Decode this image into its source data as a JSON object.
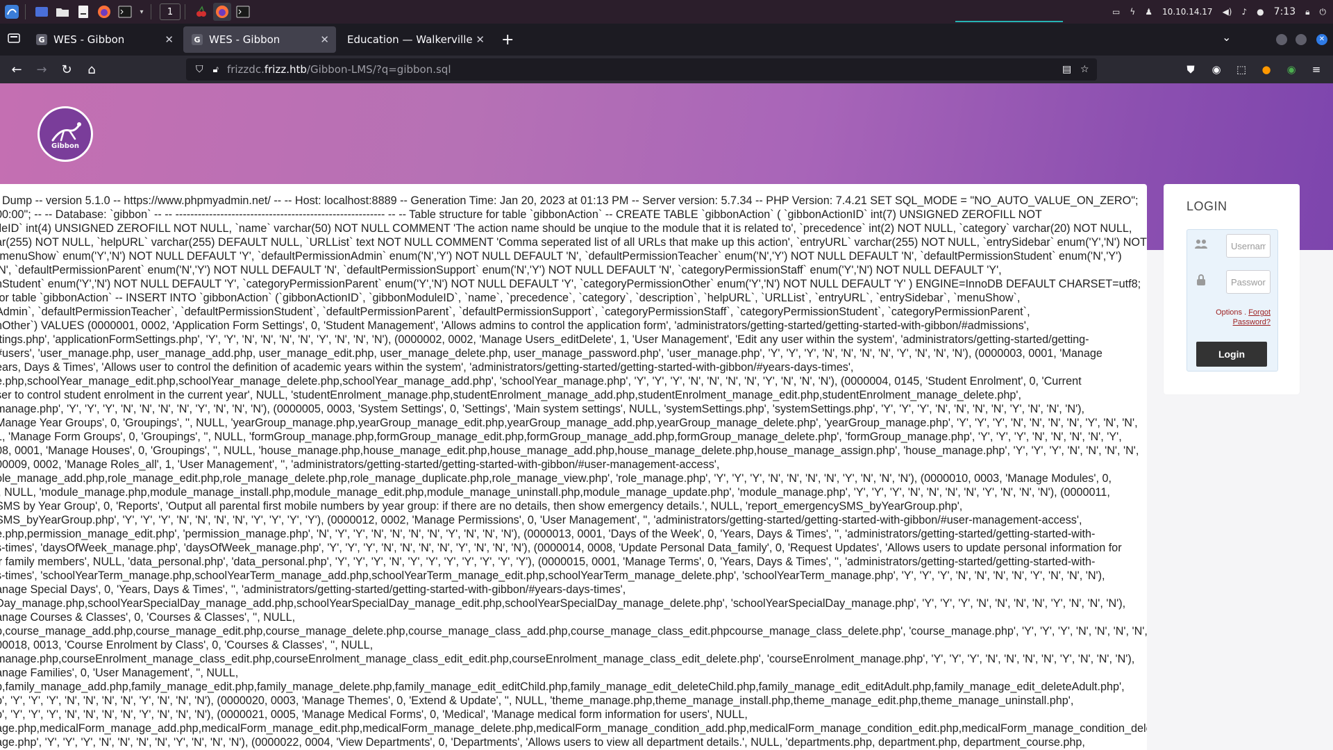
{
  "system_panel": {
    "workspace": "1",
    "ip": "10.10.14.17",
    "time": "7:13"
  },
  "browser": {
    "tabs": [
      {
        "title": "WES - Gibbon",
        "favicon": "G",
        "active": false
      },
      {
        "title": "WES - Gibbon",
        "favicon": "G",
        "active": true
      },
      {
        "title": "Education — Walkerville Elem",
        "favicon": "",
        "active": false
      }
    ],
    "url": {
      "pre": "frizzdc.",
      "host": "frizz.htb",
      "path": "/Gibbon-LMS/?q=gibbon.sql"
    }
  },
  "site": {
    "logo_text": "Gibbon"
  },
  "sql_lines": [
    ". Dump -- version 5.1.0 -- https://www.phpmyadmin.net/ -- -- Host: localhost:8889 -- Generation Time: Jan 20, 2023 at 01:13 PM -- Server version: 5.7.34 -- PHP Version: 7.4.21 SET SQL_MODE = \"NO_AUTO_VALUE_ON_ZERO\";",
    "00:00\"; -- -- Database: `gibbon` -- -- -------------------------------------------------------- -- -- Table structure for table `gibbonAction` -- CREATE TABLE `gibbonAction` ( `gibbonActionID` int(7) UNSIGNED ZEROFILL NOT",
    "ıleID` int(4) UNSIGNED ZEROFILL NOT NULL, `name` varchar(50) NOT NULL COMMENT 'The action name should be unqiue to the module that it is related to', `precedence` int(2) NOT NULL, `category` varchar(20) NOT NULL,",
    "ar(255) NOT NULL, `helpURL` varchar(255) DEFAULT NULL, `URLList` text NOT NULL COMMENT 'Comma seperated list of all URLs that make up this action', `entryURL` varchar(255) NOT NULL, `entrySidebar` enum('Y','N') NOT",
    "`menuShow` enum('Y','N') NOT NULL DEFAULT 'Y', `defaultPermissionAdmin` enum('N','Y') NOT NULL DEFAULT 'N', `defaultPermissionTeacher` enum('N','Y') NOT NULL DEFAULT 'N', `defaultPermissionStudent` enum('N','Y')",
    "'N', `defaultPermissionParent` enum('N','Y') NOT NULL DEFAULT 'N', `defaultPermissionSupport` enum('N','Y') NOT NULL DEFAULT 'N', `categoryPermissionStaff` enum('Y','N') NOT NULL DEFAULT 'Y',",
    "nStudent` enum('Y','N') NOT NULL DEFAULT 'Y', `categoryPermissionParent` enum('Y','N') NOT NULL DEFAULT 'Y', `categoryPermissionOther` enum('Y','N') NOT NULL DEFAULT 'Y' ) ENGINE=InnoDB DEFAULT CHARSET=utf8;",
    "for table `gibbonAction` -- INSERT INTO `gibbonAction` (`gibbonActionID`, `gibbonModuleID`, `name`, `precedence`, `category`, `description`, `helpURL`, `URLList`, `entryURL`, `entrySidebar`, `menuShow`,",
    "Admin`, `defaultPermissionTeacher`, `defaultPermissionStudent`, `defaultPermissionParent`, `defaultPermissionSupport`, `categoryPermissionStaff`, `categoryPermissionStudent`, `categoryPermissionParent`,",
    "nOther`) VALUES (0000001, 0002, 'Application Form Settings', 0, 'Student Management', 'Allows admins to control the application form', 'administrators/getting-started/getting-started-with-gibbon/#admissions',",
    "ttings.php', 'applicationFormSettings.php', 'Y', 'Y', 'N', 'N', 'N', 'N', 'Y', 'N', 'N', 'N'), (0000002, 0002, 'Manage Users_editDelete', 1, 'User Management', 'Edit any user within the system', 'administrators/getting-started/getting-",
    "#users', 'user_manage.php, user_manage_add.php, user_manage_edit.php, user_manage_delete.php, user_manage_password.php', 'user_manage.php', 'Y', 'Y', 'Y', 'N', 'N', 'N', 'N', 'Y', 'N', 'N', 'N'), (0000003, 0001, 'Manage",
    "ears, Days & Times', 'Allows user to control the definition of academic years within the system', 'administrators/getting-started/getting-started-with-gibbon/#years-days-times',",
    "e.php,schoolYear_manage_edit.php,schoolYear_manage_delete.php,schoolYear_manage_add.php', 'schoolYear_manage.php', 'Y', 'Y', 'Y', 'N', 'N', 'N', 'N', 'Y', 'N', 'N', 'N'), (0000004, 0145, 'Student Enrolment', 0, 'Current",
    "ser to control student enrolment in the current year', NULL, 'studentEnrolment_manage.php,studentEnrolment_manage_add.php,studentEnrolment_manage_edit.php,studentEnrolment_manage_delete.php',",
    "manage.php', 'Y', 'Y', 'Y', 'N', 'N', 'N', 'N', 'Y', 'N', 'N', 'N'), (0000005, 0003, 'System Settings', 0, 'Settings', 'Main system settings', NULL, 'systemSettings.php', 'systemSettings.php', 'Y', 'Y', 'Y', 'N', 'N', 'N', 'N', 'Y', 'N', 'N', 'N'),",
    "Manage Year Groups', 0, 'Groupings', '', NULL, 'yearGroup_manage.php,yearGroup_manage_edit.php,yearGroup_manage_add.php,yearGroup_manage_delete.php', 'yearGroup_manage.php', 'Y', 'Y', 'Y', 'N', 'N', 'N', 'N', 'Y', 'N', 'N',",
    "1, 'Manage Form Groups', 0, 'Groupings', '', NULL, 'formGroup_manage.php,formGroup_manage_edit.php,formGroup_manage_add.php,formGroup_manage_delete.php', 'formGroup_manage.php', 'Y', 'Y', 'Y', 'N', 'N', 'N', 'N', 'Y',",
    "08, 0001, 'Manage Houses', 0, 'Groupings', '', NULL, 'house_manage.php,house_manage_edit.php,house_manage_add.php,house_manage_delete.php,house_manage_assign.php', 'house_manage.php', 'Y', 'Y', 'Y', 'N', 'N', 'N', 'N',",
    "00009, 0002, 'Manage Roles_all', 1, 'User Management', '', 'administrators/getting-started/getting-started-with-gibbon/#user-management-access',",
    "ole_manage_add.php,role_manage_edit.php,role_manage_delete.php,role_manage_duplicate.php,role_manage_view.php', 'role_manage.php', 'Y', 'Y', 'Y', 'N', 'N', 'N', 'N', 'Y', 'N', 'N', 'N'), (0000010, 0003, 'Manage Modules', 0,",
    "', NULL, 'module_manage.php,module_manage_install.php,module_manage_edit.php,module_manage_uninstall.php,module_manage_update.php', 'module_manage.php', 'Y', 'Y', 'Y', 'N', 'N', 'N', 'N', 'Y', 'N', 'N', 'N'), (0000011,",
    "SMS by Year Group', 0, 'Reports', 'Output all parental first mobile numbers by year group: if there are no details, then show emergency details.', NULL, 'report_emergencySMS_byYearGroup.php',",
    "SMS_byYearGroup.php', 'Y', 'Y', 'Y', 'N', 'N', 'N', 'N', 'Y', 'Y', 'Y', 'Y'), (0000012, 0002, 'Manage Permissions', 0, 'User Management', '', 'administrators/getting-started/getting-started-with-gibbon/#user-management-access',",
    "e.php,permission_manage_edit.php', 'permission_manage.php', 'N', 'Y', 'Y', 'N', 'N', 'N', 'N', 'Y', 'N', 'N', 'N'), (0000013, 0001, 'Days of the Week', 0, 'Years, Days & Times', '', 'administrators/getting-started/getting-started-with-",
    "s-times', 'daysOfWeek_manage.php', 'daysOfWeek_manage.php', 'Y', 'Y', 'Y', 'N', 'N', 'N', 'N', 'Y', 'N', 'N', 'N'), (0000014, 0008, 'Update Personal Data_family', 0, 'Request Updates', 'Allows users to update personal information for",
    "ir family members', NULL, 'data_personal.php', 'data_personal.php', 'Y', 'Y', 'Y', 'N', 'Y', 'Y', 'Y', 'Y', 'Y', 'Y', 'Y'), (0000015, 0001, 'Manage Terms', 0, 'Years, Days & Times', '', 'administrators/getting-started/getting-started-with-",
    "s-times', 'schoolYearTerm_manage.php,schoolYearTerm_manage_add.php,schoolYearTerm_manage_edit.php,schoolYearTerm_manage_delete.php', 'schoolYearTerm_manage.php', 'Y', 'Y', 'Y', 'N', 'N', 'N', 'N', 'Y', 'N', 'N', 'N'),",
    "anage Special Days', 0, 'Years, Days & Times', '', 'administrators/getting-started/getting-started-with-gibbon/#years-days-times',",
    "Day_manage.php,schoolYearSpecialDay_manage_add.php,schoolYearSpecialDay_manage_edit.php,schoolYearSpecialDay_manage_delete.php', 'schoolYearSpecialDay_manage.php', 'Y', 'Y', 'Y', 'N', 'N', 'N', 'N', 'Y', 'N', 'N', 'N'),",
    "anage Courses & Classes', 0, 'Courses & Classes', '', NULL,",
    "p,course_manage_add.php,course_manage_edit.php,course_manage_delete.php,course_manage_class_add.php,course_manage_class_edit.phpcourse_manage_class_delete.php', 'course_manage.php', 'Y', 'Y', 'Y', 'N', 'N', 'N', 'N',",
    "00018, 0013, 'Course Enrolment by Class', 0, 'Courses & Classes', '', NULL,",
    "manage.php,courseEnrolment_manage_class_edit.php,courseEnrolment_manage_class_edit_edit.php,courseEnrolment_manage_class_edit_delete.php', 'courseEnrolment_manage.php', 'Y', 'Y', 'Y', 'N', 'N', 'N', 'N', 'Y', 'N', 'N', 'N'),",
    "anage Families', 0, 'User Management', '', NULL,",
    "p,family_manage_add.php,family_manage_edit.php,family_manage_delete.php,family_manage_edit_editChild.php,family_manage_edit_deleteChild.php,family_manage_edit_editAdult.php,family_manage_edit_deleteAdult.php',",
    "p', 'Y', 'Y', 'Y', 'N', 'N', 'N', 'N', 'Y', 'N', 'N', 'N'), (0000020, 0003, 'Manage Themes', 0, 'Extend & Update', '', NULL, 'theme_manage.php,theme_manage_install.php,theme_manage_edit.php,theme_manage_uninstall.php',",
    "p', 'Y', 'Y', 'Y', 'N', 'N', 'N', 'N', 'Y', 'N', 'N', 'N'), (0000021, 0005, 'Manage Medical Forms', 0, 'Medical', 'Manage medical form information for users', NULL,",
    "age.php,medicalForm_manage_add.php,medicalForm_manage_edit.php,medicalForm_manage_delete.php,medicalForm_manage_condition_add.php,medicalForm_manage_condition_edit.php,medicalForm_manage_condition_delete.php',",
    "age.php', 'Y', 'Y', 'Y', 'N', 'N', 'N', 'N', 'Y', 'N', 'N', 'N'), (0000022, 0004, 'View Departments', 0, 'Departments', 'Allows users to view all department details.', NULL, 'departments.php, department.php, department_course.php,"
  ],
  "login": {
    "title": "LOGIN",
    "username_placeholder": "Username",
    "password_placeholder": "Password",
    "options_label": "Options",
    "separator": ".",
    "forgot_label": "Forgot Password?",
    "button_label": "Login"
  }
}
